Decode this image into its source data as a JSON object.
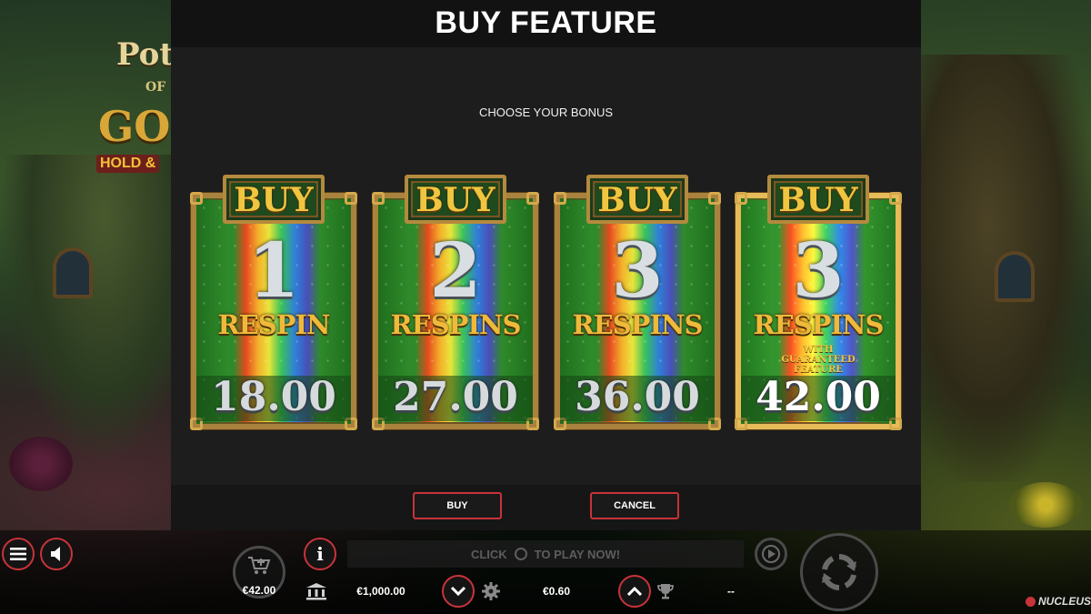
{
  "modal": {
    "title": "BUY FEATURE",
    "subtitle": "CHOOSE YOUR BONUS",
    "buy_button": "BUY",
    "cancel_button": "CANCEL"
  },
  "cards": [
    {
      "plaque": "BUY",
      "number": "1",
      "label": "RESPIN",
      "sub": "",
      "price": "18.00",
      "selected": false
    },
    {
      "plaque": "BUY",
      "number": "2",
      "label": "RESPINS",
      "sub": "",
      "price": "27.00",
      "selected": false
    },
    {
      "plaque": "BUY",
      "number": "3",
      "label": "RESPINS",
      "sub": "",
      "price": "36.00",
      "selected": false
    },
    {
      "plaque": "BUY",
      "number": "3",
      "label": "RESPINS",
      "sub": "WITH GUARANTEED FEATURE",
      "price": "42.00",
      "selected": true
    }
  ],
  "background": {
    "logo_line1": "Pot",
    "logo_line2": "OF",
    "logo_line3": "GO",
    "logo_line4": "HOLD &"
  },
  "bottom_bar": {
    "buy_feature_amount": "€42.00",
    "balance": "€1,000.00",
    "bet": "€0.60",
    "win": "--",
    "click_prompt_left": "CLICK",
    "click_prompt_right": "TO PLAY NOW!",
    "brand": "NUCLEUS"
  },
  "icons": [
    "menu-icon",
    "sound-icon",
    "cart-icon",
    "info-icon",
    "bank-icon",
    "chevron-down-icon",
    "settings-icon",
    "chevron-up-icon",
    "trophy-icon",
    "autoplay-icon",
    "spin-icon"
  ],
  "colors": {
    "accent": "#c8333a",
    "modal_bg": "#1d1d1d",
    "gold": "#f0c640"
  }
}
